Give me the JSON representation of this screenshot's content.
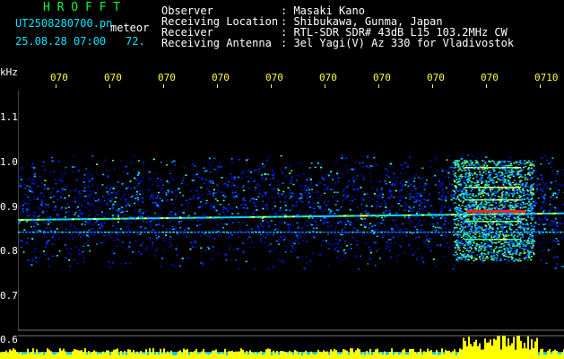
{
  "app": {
    "title": "H R O F F T",
    "file_name": "UT2508280700.pn",
    "mode": "meteor",
    "datetime": "25.08.28 07:00",
    "count": "72."
  },
  "info": [
    {
      "label": "Observer",
      "value": ": Masaki Kano"
    },
    {
      "label": "Receiving Location",
      "value": ": Shibukawa, Gunma, Japan"
    },
    {
      "label": "Receiver",
      "value": ": RTL-SDR SDR# 43dB L15 103.2MHz CW"
    },
    {
      "label": "Receiving Antenna",
      "value": ": 3el Yagi(V) Az 330 for Vladivostok"
    }
  ],
  "axis": {
    "unit": "kHz",
    "y_ticks": [
      "1.1",
      "1.0",
      "0.9",
      "0.8",
      "0.7",
      "0.6"
    ],
    "x_ticks": [
      "070",
      "070",
      "070",
      "070",
      "070",
      "070",
      "070",
      "070",
      "070",
      "0710"
    ]
  },
  "colors": {
    "background": "#000000",
    "label_white": "#ffffff",
    "label_cyan": "#00e6ff",
    "title_green": "#00ff3c",
    "tick_yellow": "#ffff33",
    "noise_blue": "#0022ff",
    "signal_red": "#ff2020",
    "activity_yellow": "#ffff00"
  }
}
